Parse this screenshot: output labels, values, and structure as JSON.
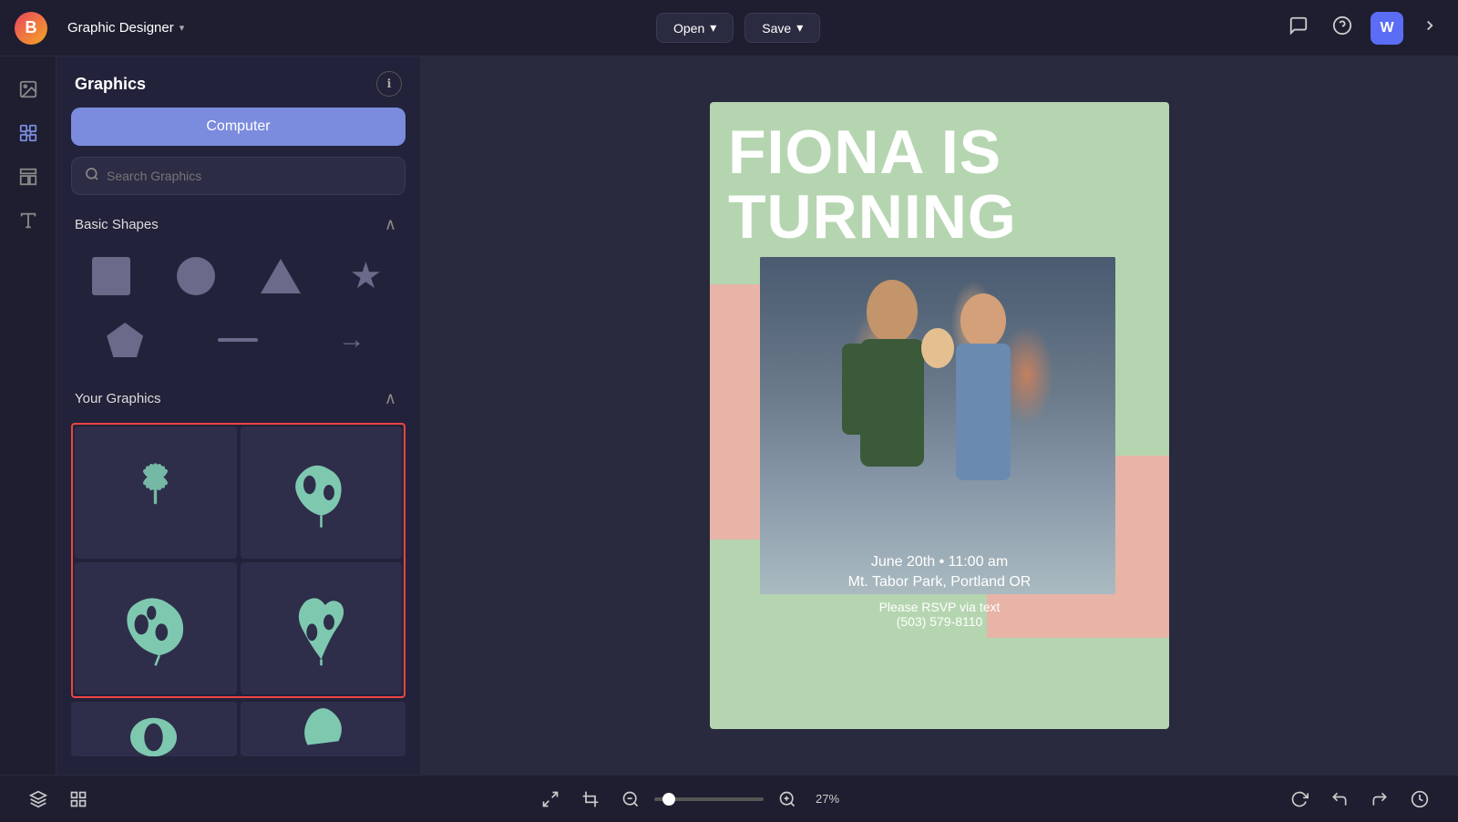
{
  "app": {
    "logo": "B",
    "title": "Graphic Designer",
    "title_chevron": "▾"
  },
  "topbar": {
    "open_btn": "Open",
    "open_chevron": "▾",
    "save_btn": "Save",
    "save_chevron": "▾"
  },
  "topbar_icons": {
    "message_icon": "💬",
    "help_icon": "?",
    "avatar_label": "W",
    "expand_icon": "⟩"
  },
  "left_panel": {
    "title": "Graphics",
    "computer_btn": "Computer",
    "search_placeholder": "Search Graphics"
  },
  "basic_shapes": {
    "title": "Basic Shapes",
    "collapse": "∧"
  },
  "your_graphics": {
    "title": "Your Graphics",
    "collapse": "∧"
  },
  "design_card": {
    "title_line1": "FIONA IS",
    "title_line2": "TURNING",
    "date": "June 20th • 11:00 am",
    "location": "Mt. Tabor Park, Portland OR",
    "rsvp": "Please RSVP via text",
    "phone": "(503) 579-8110"
  },
  "bottom_toolbar": {
    "zoom_value": "27%",
    "zoom_pct": 27
  }
}
